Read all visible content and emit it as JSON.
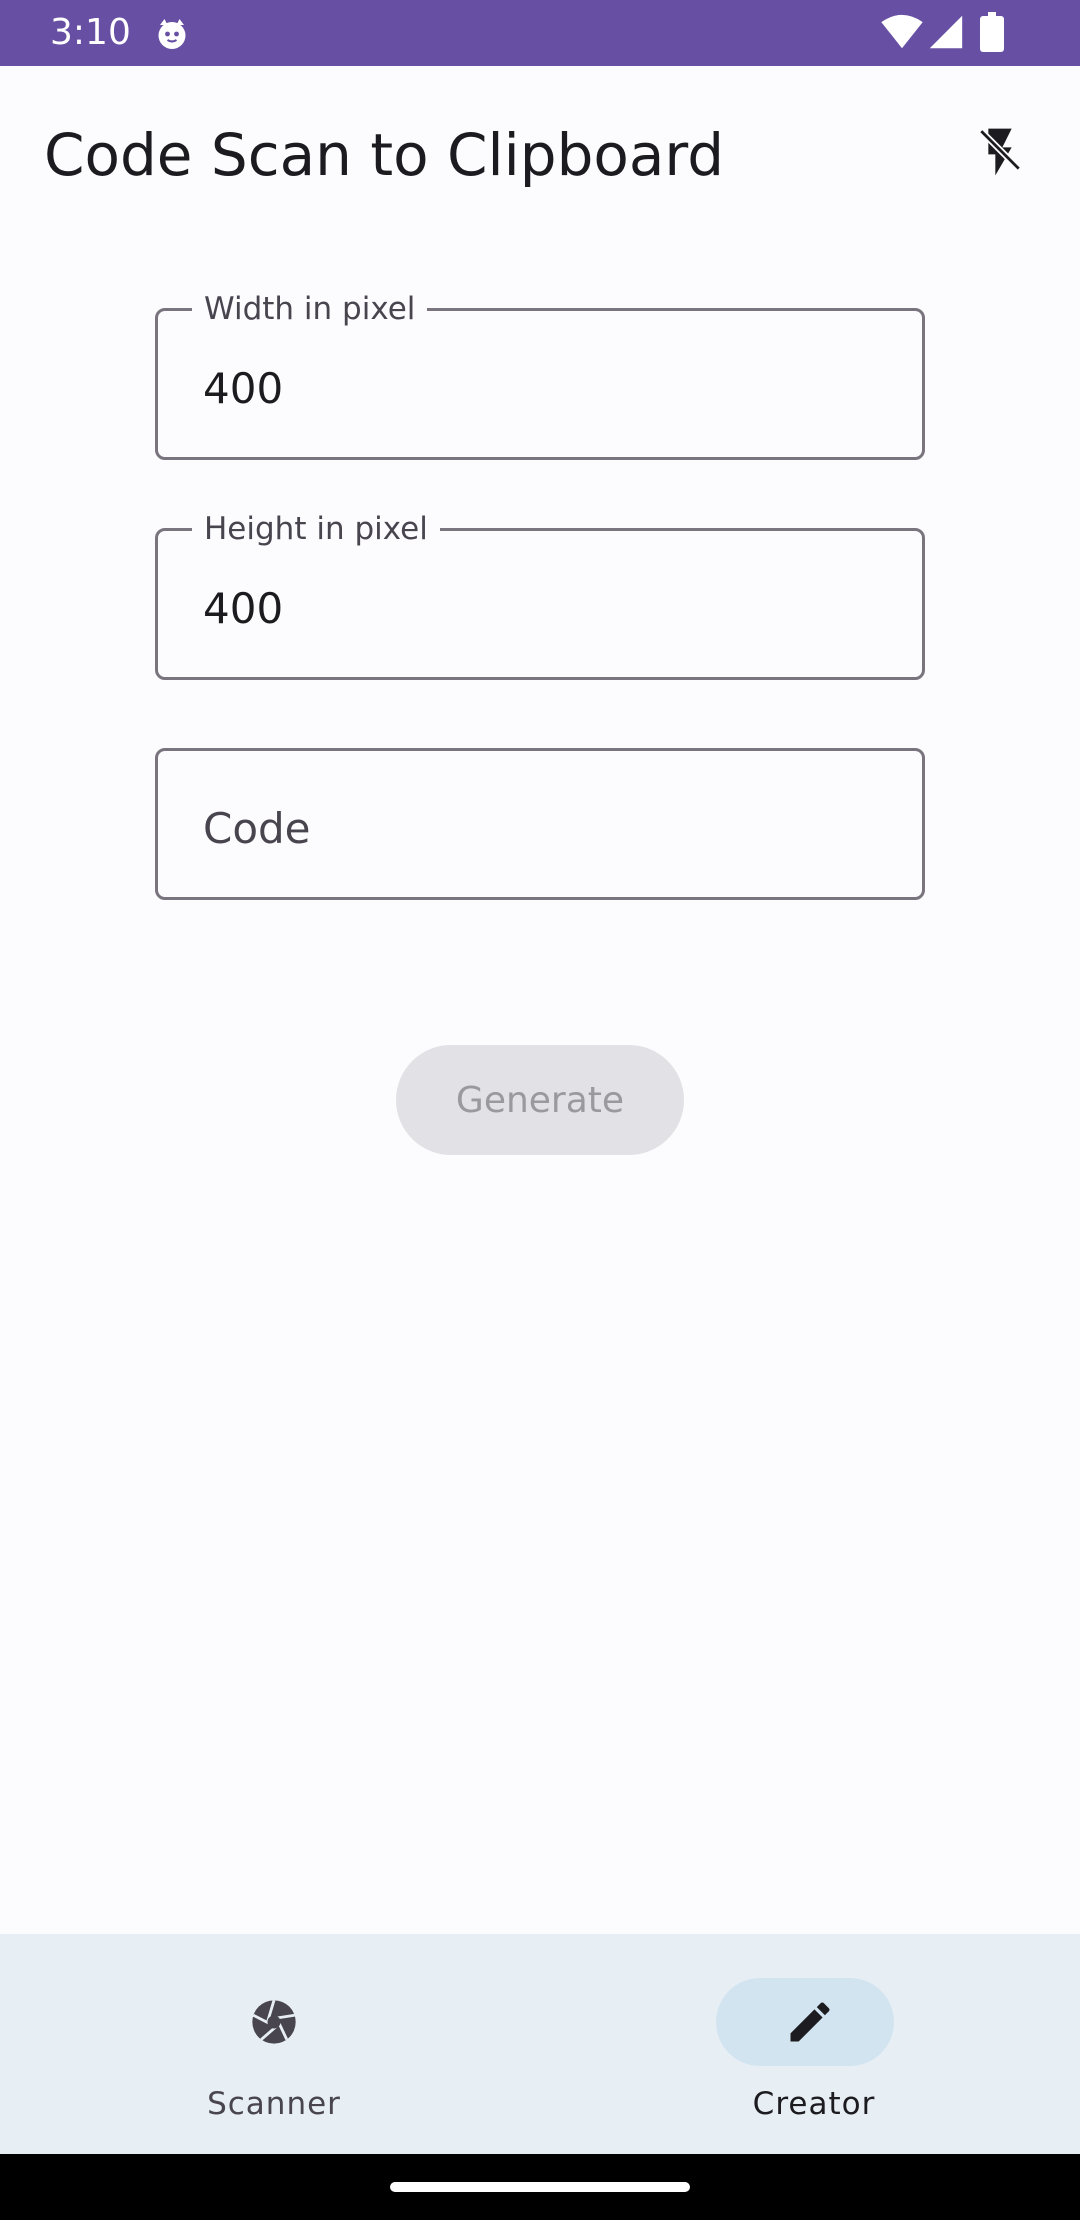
{
  "status_bar": {
    "time": "3:10",
    "icons": [
      "cat-icon",
      "wifi-icon",
      "signal-icon",
      "battery-icon"
    ],
    "background": "#6750a4"
  },
  "app_bar": {
    "title": "Code Scan to Clipboard",
    "action_icon": "flash-off-icon"
  },
  "form": {
    "width_field": {
      "label": "Width in pixel",
      "value": "400"
    },
    "height_field": {
      "label": "Height in pixel",
      "value": "400"
    },
    "code_field": {
      "placeholder": "Code",
      "value": ""
    },
    "generate_label": "Generate",
    "generate_enabled": false
  },
  "bottom_nav": {
    "items": [
      {
        "label": "Scanner",
        "icon": "camera-shutter-icon",
        "selected": false
      },
      {
        "label": "Creator",
        "icon": "pencil-icon",
        "selected": true
      }
    ],
    "background": "#e7eef4",
    "selected_indicator": "#d3e4f1"
  }
}
